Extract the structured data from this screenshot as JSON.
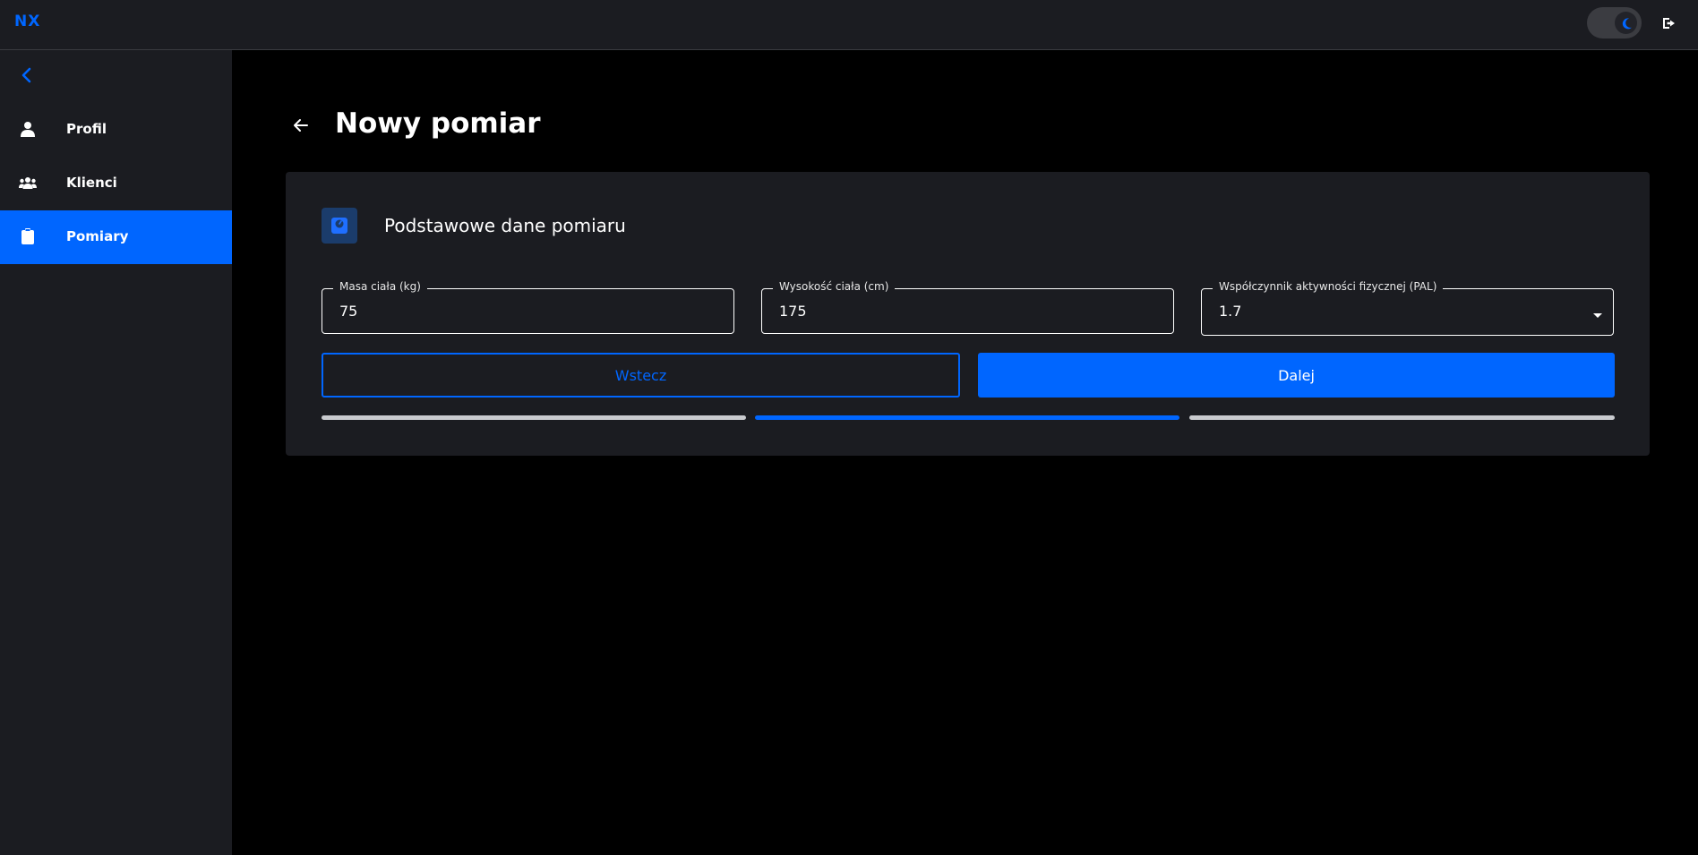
{
  "app": {
    "logo": "NX",
    "accent_color": "#0066ff"
  },
  "topbar": {
    "theme_toggle_icon": "moon-icon",
    "logout_icon": "logout-icon"
  },
  "sidebar": {
    "collapse_icon": "chevron-left-icon",
    "items": [
      {
        "label": "Profil",
        "icon": "person-icon",
        "active": false
      },
      {
        "label": "Klienci",
        "icon": "users-icon",
        "active": false
      },
      {
        "label": "Pomiary",
        "icon": "clipboard-icon",
        "active": true
      }
    ]
  },
  "page": {
    "title": "Nowy pomiar",
    "back_icon": "arrow-left-icon"
  },
  "card": {
    "icon": "scale-icon",
    "title": "Podstawowe dane pomiaru",
    "fields": [
      {
        "label": "Masa ciała (kg)",
        "value": "75"
      },
      {
        "label": "Wysokość ciała (cm)",
        "value": "175"
      },
      {
        "label": "Współczynnik aktywności fizycznej (PAL)",
        "value": "1.7"
      }
    ],
    "back_button": "Wstecz",
    "next_button": "Dalej",
    "steps": {
      "total": 3,
      "current": 2
    }
  }
}
